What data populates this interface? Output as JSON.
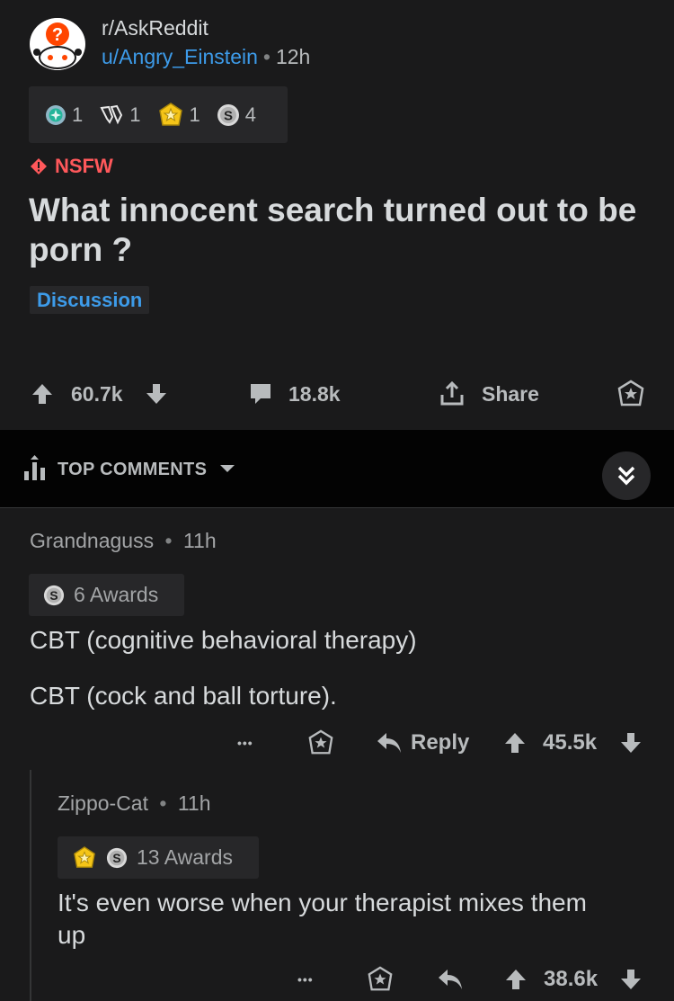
{
  "post": {
    "subreddit": "r/AskReddit",
    "author": "u/Angry_Einstein",
    "separator": "•",
    "age": "12h",
    "awards": [
      {
        "icon": "medal-icon",
        "count": "1"
      },
      {
        "icon": "clapping-hands-icon",
        "count": "1"
      },
      {
        "icon": "gold-star-icon",
        "count": "1"
      },
      {
        "icon": "silver-coin-icon",
        "count": "4"
      }
    ],
    "nsfw_label": "NSFW",
    "title": "What innocent search turned out to be porn ?",
    "flair": "Discussion",
    "upvotes": "60.7k",
    "comments": "18.8k",
    "share_label": "Share"
  },
  "sort": {
    "label": "TOP COMMENTS"
  },
  "comments": [
    {
      "author": "Grandnaguss",
      "separator": "•",
      "age": "11h",
      "awards_label": "6 Awards",
      "paragraphs": [
        "CBT (cognitive behavioral therapy)",
        "CBT (cock and ball torture)."
      ],
      "more_label": "•••",
      "reply_label": "Reply",
      "score": "45.5k"
    },
    {
      "author": "Zippo-Cat",
      "separator": "•",
      "age": "11h",
      "awards_label": "13 Awards",
      "paragraphs": [
        "It's even worse when your therapist mixes them up"
      ],
      "more_label": "•••",
      "score": "38.6k"
    }
  ],
  "colors": {
    "background": "#1a1a1b",
    "sort_bar": "#030303",
    "link_blue": "#3d9be9",
    "nsfw_red": "#ff585b",
    "award_box": "#272729"
  }
}
